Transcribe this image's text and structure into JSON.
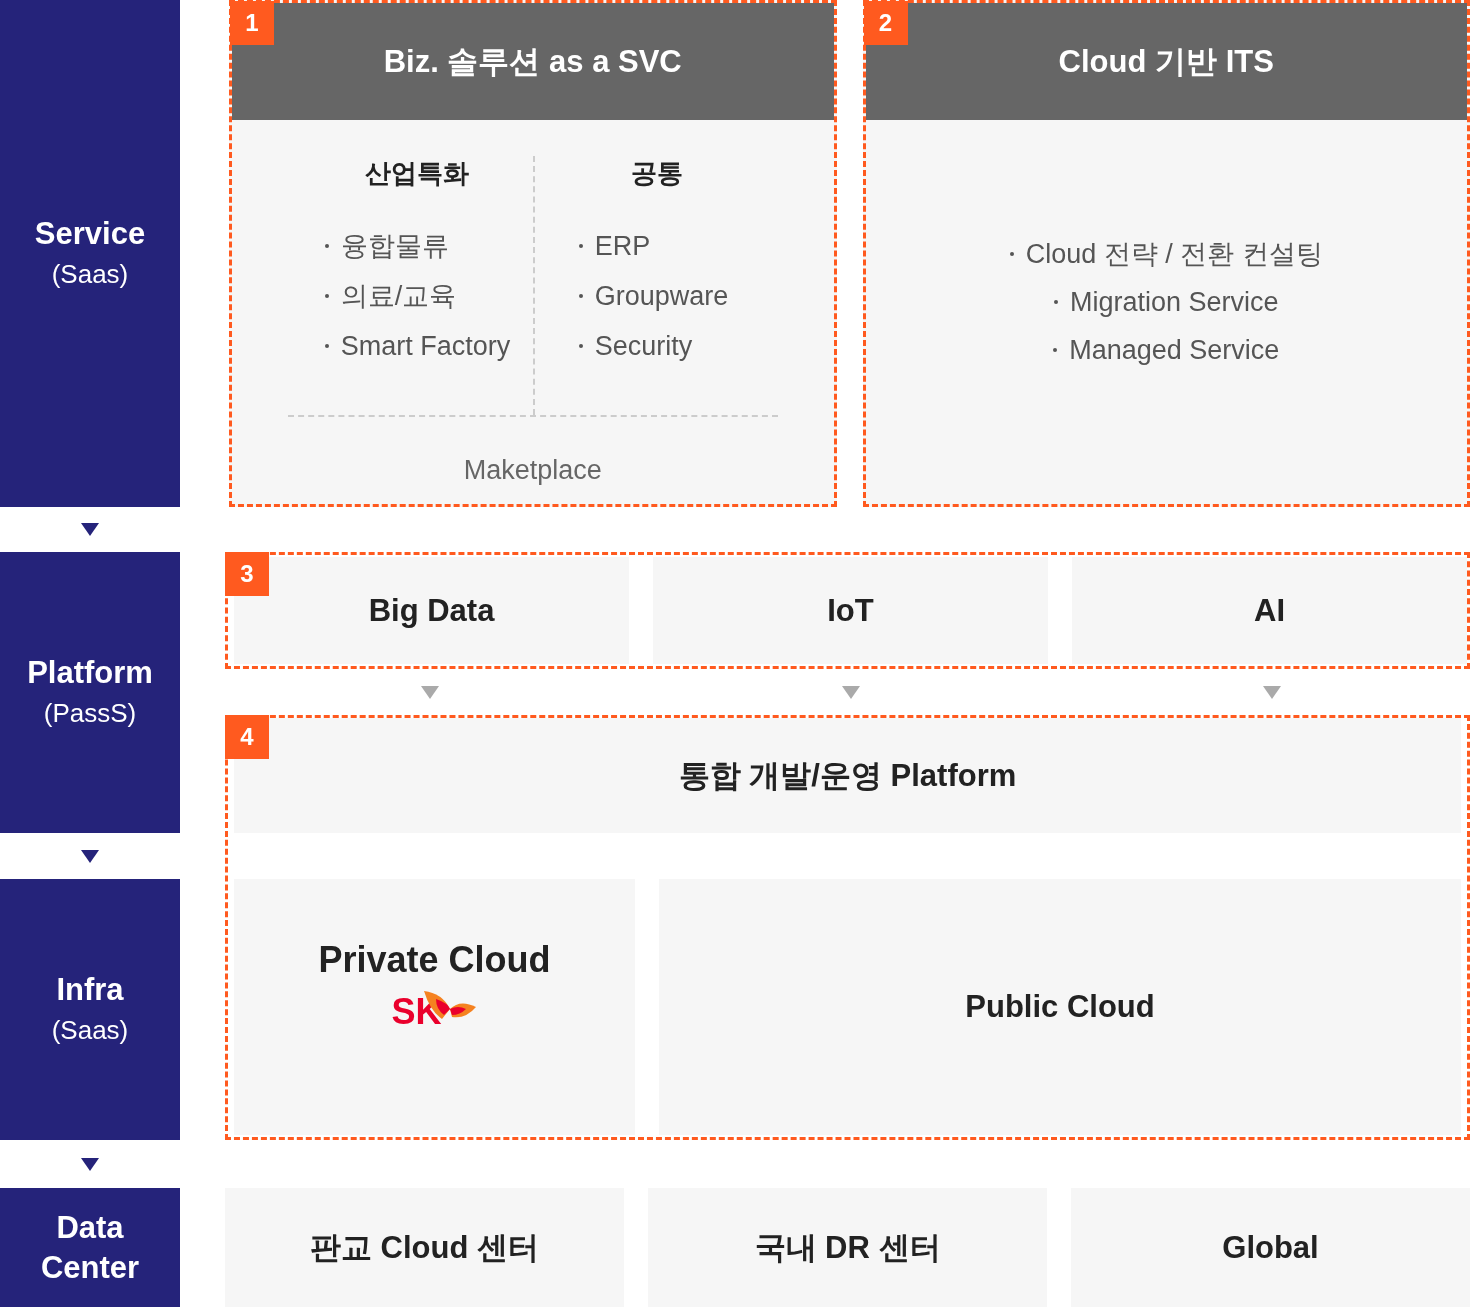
{
  "layers": [
    {
      "title": "Service",
      "subtitle": "(Saas)"
    },
    {
      "title": "Platform",
      "subtitle": "(PassS)"
    },
    {
      "title": "Infra",
      "subtitle": "(Saas)"
    },
    {
      "title": "Data Center"
    }
  ],
  "service": [
    {
      "number": "1",
      "title": "Biz. 솔루션 as a SVC",
      "columns": [
        {
          "heading": "산업특화",
          "items": [
            "융합물류",
            "의료/교육",
            "Smart Factory"
          ]
        },
        {
          "heading": "공통",
          "items": [
            "ERP",
            "Groupware",
            "Security"
          ]
        }
      ],
      "footer": "Maketplace"
    },
    {
      "number": "2",
      "title": "Cloud 기반 ITS",
      "items": [
        "Cloud 전략 / 전환 컨설팅",
        "Migration Service",
        "Managed Service"
      ]
    }
  ],
  "platform": {
    "number": "3",
    "items": [
      "Big Data",
      "IoT",
      "AI"
    ]
  },
  "integrated": {
    "number": "4",
    "title": "통합 개발/운영 Platform",
    "clouds": [
      {
        "title": "Private Cloud",
        "logo_text": "SK"
      },
      {
        "title": "Public Cloud"
      }
    ]
  },
  "data_center": [
    "판교 Cloud 센터",
    "국내 DR 센터",
    "Global"
  ]
}
